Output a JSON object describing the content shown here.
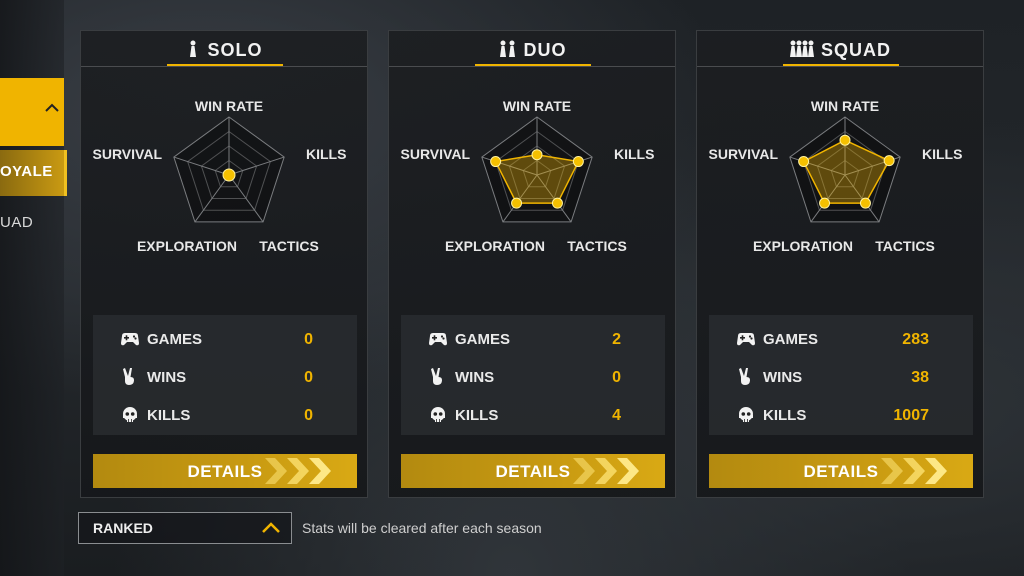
{
  "sidebar": {
    "items": [
      {
        "label": "OYALE",
        "active": true
      },
      {
        "label": "UAD",
        "active": false
      }
    ]
  },
  "panels": [
    {
      "mode": "SOLO",
      "mode_icon": "solo-figure-icon",
      "axes": {
        "top": "WIN RATE",
        "left": "SURVIVAL",
        "right": "KILLS",
        "bottom_left": "EXPLORATION",
        "bottom_right": "TACTICS"
      },
      "radar_levels": {
        "win_rate": 0.0,
        "kills": 0.0,
        "tactics": 0.0,
        "exploration": 0.0,
        "survival": 0.0
      },
      "stats": [
        {
          "label": "GAMES",
          "value": "0",
          "icon": "gamepad-icon"
        },
        {
          "label": "WINS",
          "value": "0",
          "icon": "victory-hand-icon"
        },
        {
          "label": "KILLS",
          "value": "0",
          "icon": "skull-icon"
        }
      ],
      "details_label": "DETAILS"
    },
    {
      "mode": "DUO",
      "mode_icon": "duo-figures-icon",
      "axes": {
        "top": "WIN RATE",
        "left": "SURVIVAL",
        "right": "KILLS",
        "bottom_left": "EXPLORATION",
        "bottom_right": "TACTICS"
      },
      "radar_levels": {
        "win_rate": 0.35,
        "kills": 0.75,
        "tactics": 0.6,
        "exploration": 0.6,
        "survival": 0.75
      },
      "stats": [
        {
          "label": "GAMES",
          "value": "2",
          "icon": "gamepad-icon"
        },
        {
          "label": "WINS",
          "value": "0",
          "icon": "victory-hand-icon"
        },
        {
          "label": "KILLS",
          "value": "4",
          "icon": "skull-icon"
        }
      ],
      "details_label": "DETAILS"
    },
    {
      "mode": "SQUAD",
      "mode_icon": "squad-figures-icon",
      "axes": {
        "top": "WIN RATE",
        "left": "SURVIVAL",
        "right": "KILLS",
        "bottom_left": "EXPLORATION",
        "bottom_right": "TACTICS"
      },
      "radar_levels": {
        "win_rate": 0.6,
        "kills": 0.8,
        "tactics": 0.6,
        "exploration": 0.6,
        "survival": 0.75
      },
      "stats": [
        {
          "label": "GAMES",
          "value": "283",
          "icon": "gamepad-icon"
        },
        {
          "label": "WINS",
          "value": "38",
          "icon": "victory-hand-icon"
        },
        {
          "label": "KILLS",
          "value": "1007",
          "icon": "skull-icon"
        }
      ],
      "details_label": "DETAILS"
    }
  ],
  "footer": {
    "ranked_label": "RANKED",
    "note": "Stats will be cleared after each season"
  },
  "colors": {
    "accent": "#f0b400",
    "panel": "#1c1e21",
    "stats_bg": "#282b2f"
  }
}
